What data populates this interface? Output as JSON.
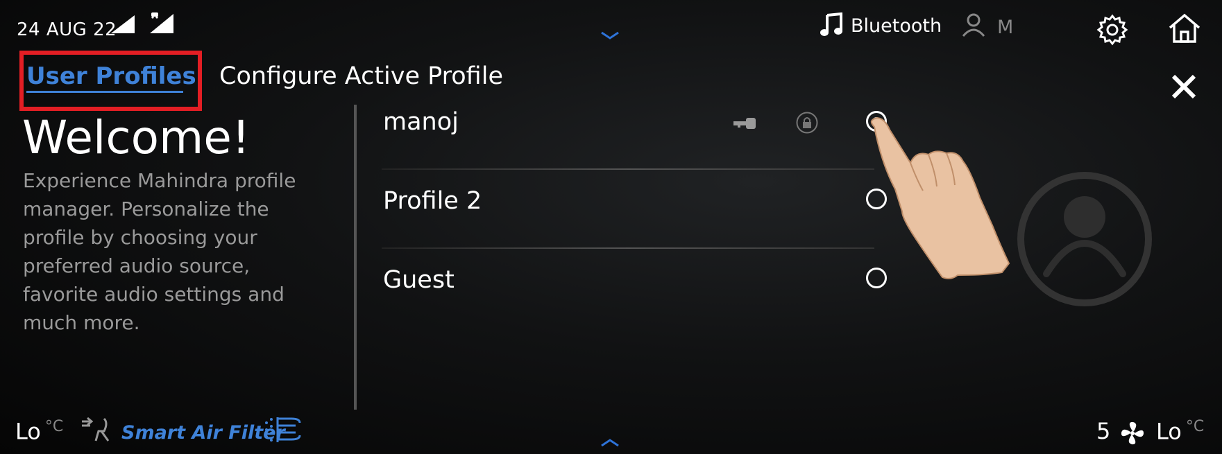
{
  "status_bar": {
    "date": "24 AUG 22",
    "media_label": "Bluetooth",
    "user_initial": "M"
  },
  "tabs": {
    "user_profiles": "User Profiles",
    "configure_active_profile": "Configure Active Profile"
  },
  "welcome": {
    "title": "Welcome!",
    "description": "Experience Mahindra profile manager. Personalize the profile by choosing your preferred audio source, favorite audio settings and much more."
  },
  "profiles": [
    {
      "name": "manoj",
      "selected": true
    },
    {
      "name": "Profile 2",
      "selected": false
    },
    {
      "name": "Guest",
      "selected": false
    }
  ],
  "climate": {
    "left_temp": "Lo",
    "left_unit": "°C",
    "smart_air_filter": "Smart Air Filter",
    "fan_speed": "5",
    "right_temp": "Lo",
    "right_unit": "°C"
  },
  "colors": {
    "accent": "#3f82d8",
    "highlight_box": "#e31e24"
  }
}
